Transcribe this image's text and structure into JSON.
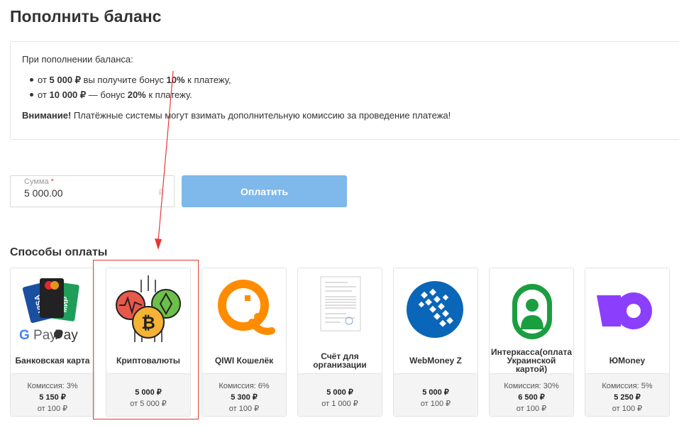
{
  "page_title": "Пополнить баланс",
  "info": {
    "intro": "При пополнении баланса:",
    "bonus_items": [
      {
        "prefix": "от ",
        "amount": "5 000 ₽",
        "middle": " вы получите бонус ",
        "percent": "10%",
        "suffix": " к платежу,"
      },
      {
        "prefix": "от ",
        "amount": "10 000 ₽",
        "middle": " — бонус ",
        "percent": "20%",
        "suffix": " к платежу."
      }
    ],
    "warning_title": "Внимание!",
    "warning_text": " Платёжные системы могут взимать дополнительную комиссию за проведение платежа!"
  },
  "amount_field": {
    "label": "Сумма",
    "required_mark": "*",
    "value": "5 000.00",
    "currency": "₽"
  },
  "pay_button": "Оплатить",
  "payment_methods_title": "Способы оплаты",
  "payment_methods": [
    {
      "icon": "bank-cards-icon",
      "name": "Банковская карта",
      "commission": "Комиссия: 3%",
      "price": "5 150 ₽",
      "min": "от 100 ₽"
    },
    {
      "icon": "crypto-icon",
      "name": "Криптовалюты",
      "commission": "",
      "price": "5 000 ₽",
      "min": "от 5 000 ₽"
    },
    {
      "icon": "qiwi-icon",
      "name": "QIWI Кошелёк",
      "commission": "Комиссия: 6%",
      "price": "5 300 ₽",
      "min": "от 100 ₽"
    },
    {
      "icon": "invoice-icon",
      "name": "Счёт для организации",
      "commission": "",
      "price": "5 000 ₽",
      "min": "от 1 000 ₽"
    },
    {
      "icon": "webmoney-icon",
      "name": "WebMoney Z",
      "commission": "",
      "price": "5 000 ₽",
      "min": "от 100 ₽"
    },
    {
      "icon": "interkassa-icon",
      "name": "Интеркасса(оплата Украинской картой)",
      "commission": "Комиссия: 30%",
      "price": "6 500 ₽",
      "min": "от 100 ₽"
    },
    {
      "icon": "yoomoney-icon",
      "name": "ЮMoney",
      "commission": "Комиссия: 5%",
      "price": "5 250 ₽",
      "min": "от 100 ₽"
    }
  ],
  "colors": {
    "pay_button": "#7fb8ea",
    "annotation": "#e53935",
    "qiwi": "#ff8c00",
    "webmoney": "#0a66b8",
    "interkassa": "#1a9e3f",
    "yoomoney": "#8b3ffd"
  }
}
